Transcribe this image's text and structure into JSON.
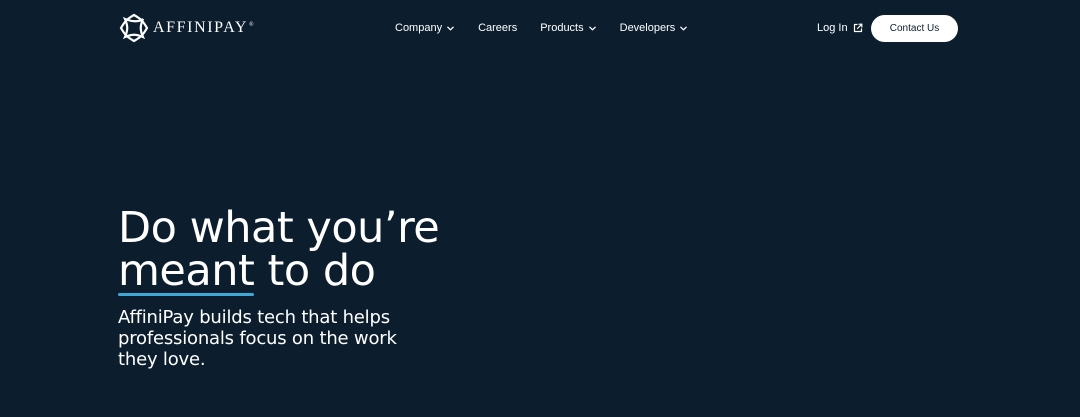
{
  "brand": {
    "logo_text": "AFFINIPAY",
    "logo_tm": "®",
    "logo_icon": "affinipay-logo-icon"
  },
  "nav": {
    "items": [
      {
        "label": "Company",
        "has_dropdown": true,
        "icon": "chevron-down-icon"
      },
      {
        "label": "Careers",
        "has_dropdown": false
      },
      {
        "label": "Products",
        "has_dropdown": true,
        "icon": "chevron-down-icon"
      },
      {
        "label": "Developers",
        "has_dropdown": true,
        "icon": "chevron-down-icon"
      }
    ],
    "login_label": "Log In",
    "login_icon": "external-link-icon",
    "contact_label": "Contact Us"
  },
  "hero": {
    "title_line1": "Do what you’re",
    "title_line2_underlined": "meant",
    "title_line2_rest": " to do",
    "subtitle": "AffiniPay builds tech that helps professionals focus on the work they love."
  },
  "colors": {
    "background": "#0c1e2e",
    "text": "#ffffff",
    "accent_underline": "#3fa9d6",
    "button_bg": "#ffffff",
    "button_text": "#0c1e2e"
  }
}
